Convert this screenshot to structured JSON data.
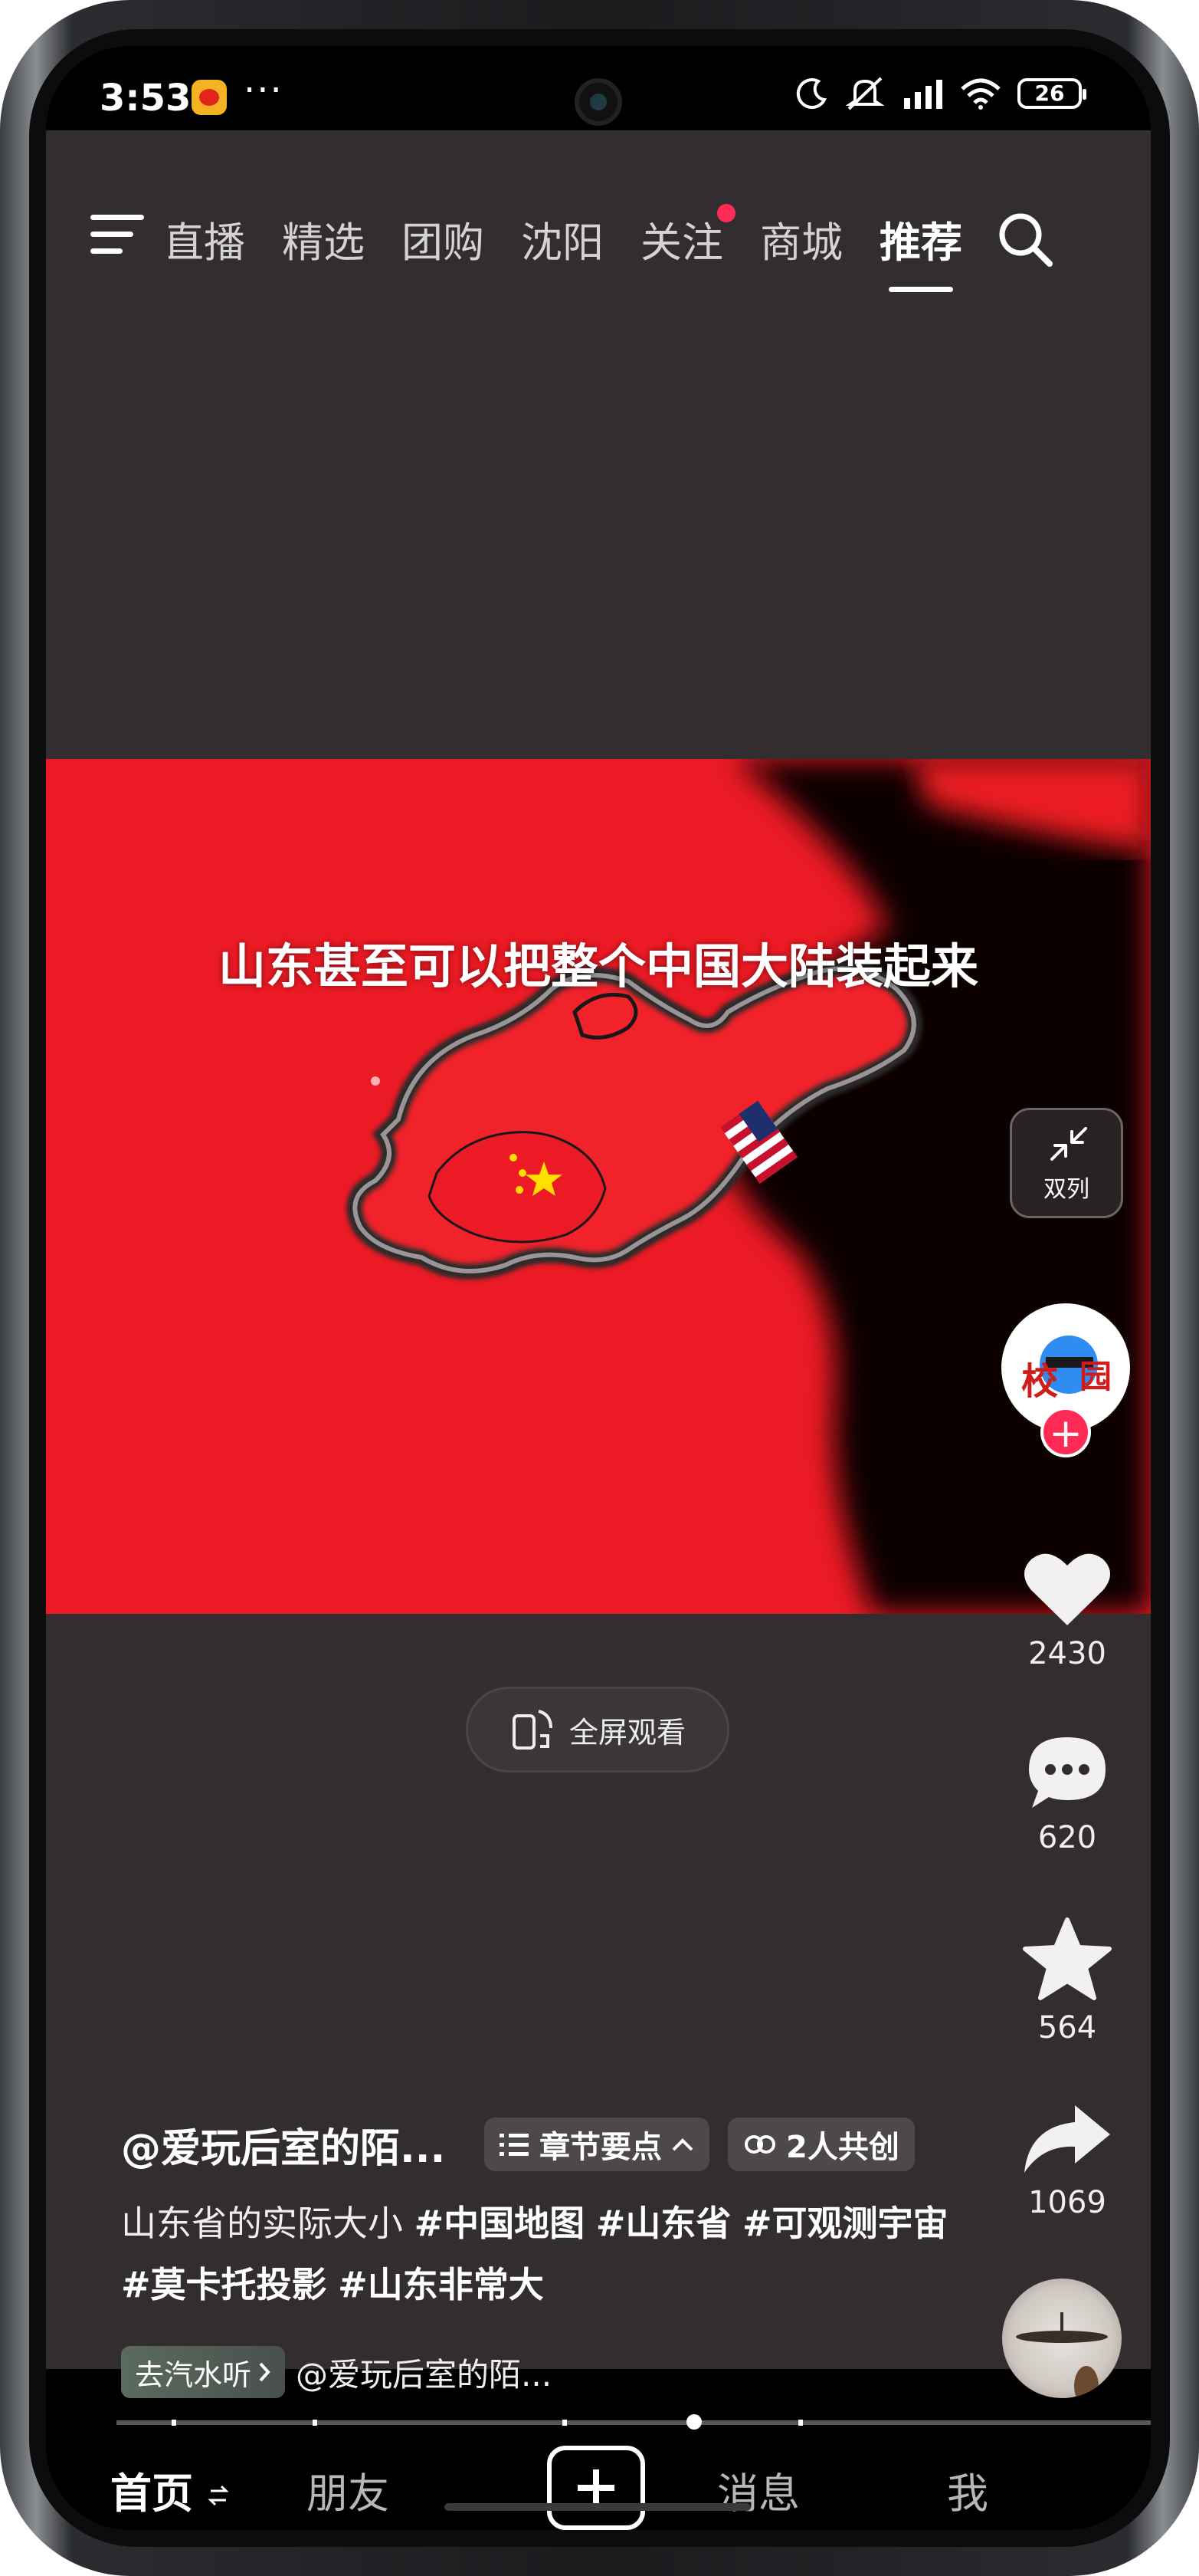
{
  "status_bar": {
    "time": "3:53",
    "dots": "···",
    "battery": "26",
    "icons": [
      "weibo-icon",
      "moon-icon",
      "mute-icon",
      "signal-icon",
      "wifi-icon",
      "battery-icon"
    ]
  },
  "top_nav": {
    "tabs": [
      {
        "label": "直播"
      },
      {
        "label": "精选"
      },
      {
        "label": "团购"
      },
      {
        "label": "沈阳"
      },
      {
        "label": "关注"
      },
      {
        "label": "商城"
      },
      {
        "label": "推荐"
      }
    ],
    "active_tab": "推荐"
  },
  "video": {
    "caption": "山东甚至可以把整个中国大陆装起来"
  },
  "right_rail": {
    "dual_label": "双列",
    "likes": "2430",
    "comments": "620",
    "favorites": "564",
    "shares": "1069"
  },
  "fullscreen": {
    "label": "全屏观看"
  },
  "post": {
    "author": "@爱玩后室的陌...",
    "chapters_label": "章节要点",
    "collab_label": "2人共创",
    "description": "山东省的实际大小",
    "tags": [
      "#中国地图",
      "#山东省",
      "#可观测宇宙",
      "#莫卡托投影",
      "#山东非常大"
    ],
    "music_badge": "去汽水听",
    "music_name": "@爱玩后室的陌..."
  },
  "bottom_bar": {
    "home": "首页",
    "friends": "朋友",
    "messages": "消息",
    "me": "我"
  },
  "colors": {
    "accent": "#fe2c55",
    "background": "#322e2f",
    "video_red": "#ec1a24"
  }
}
